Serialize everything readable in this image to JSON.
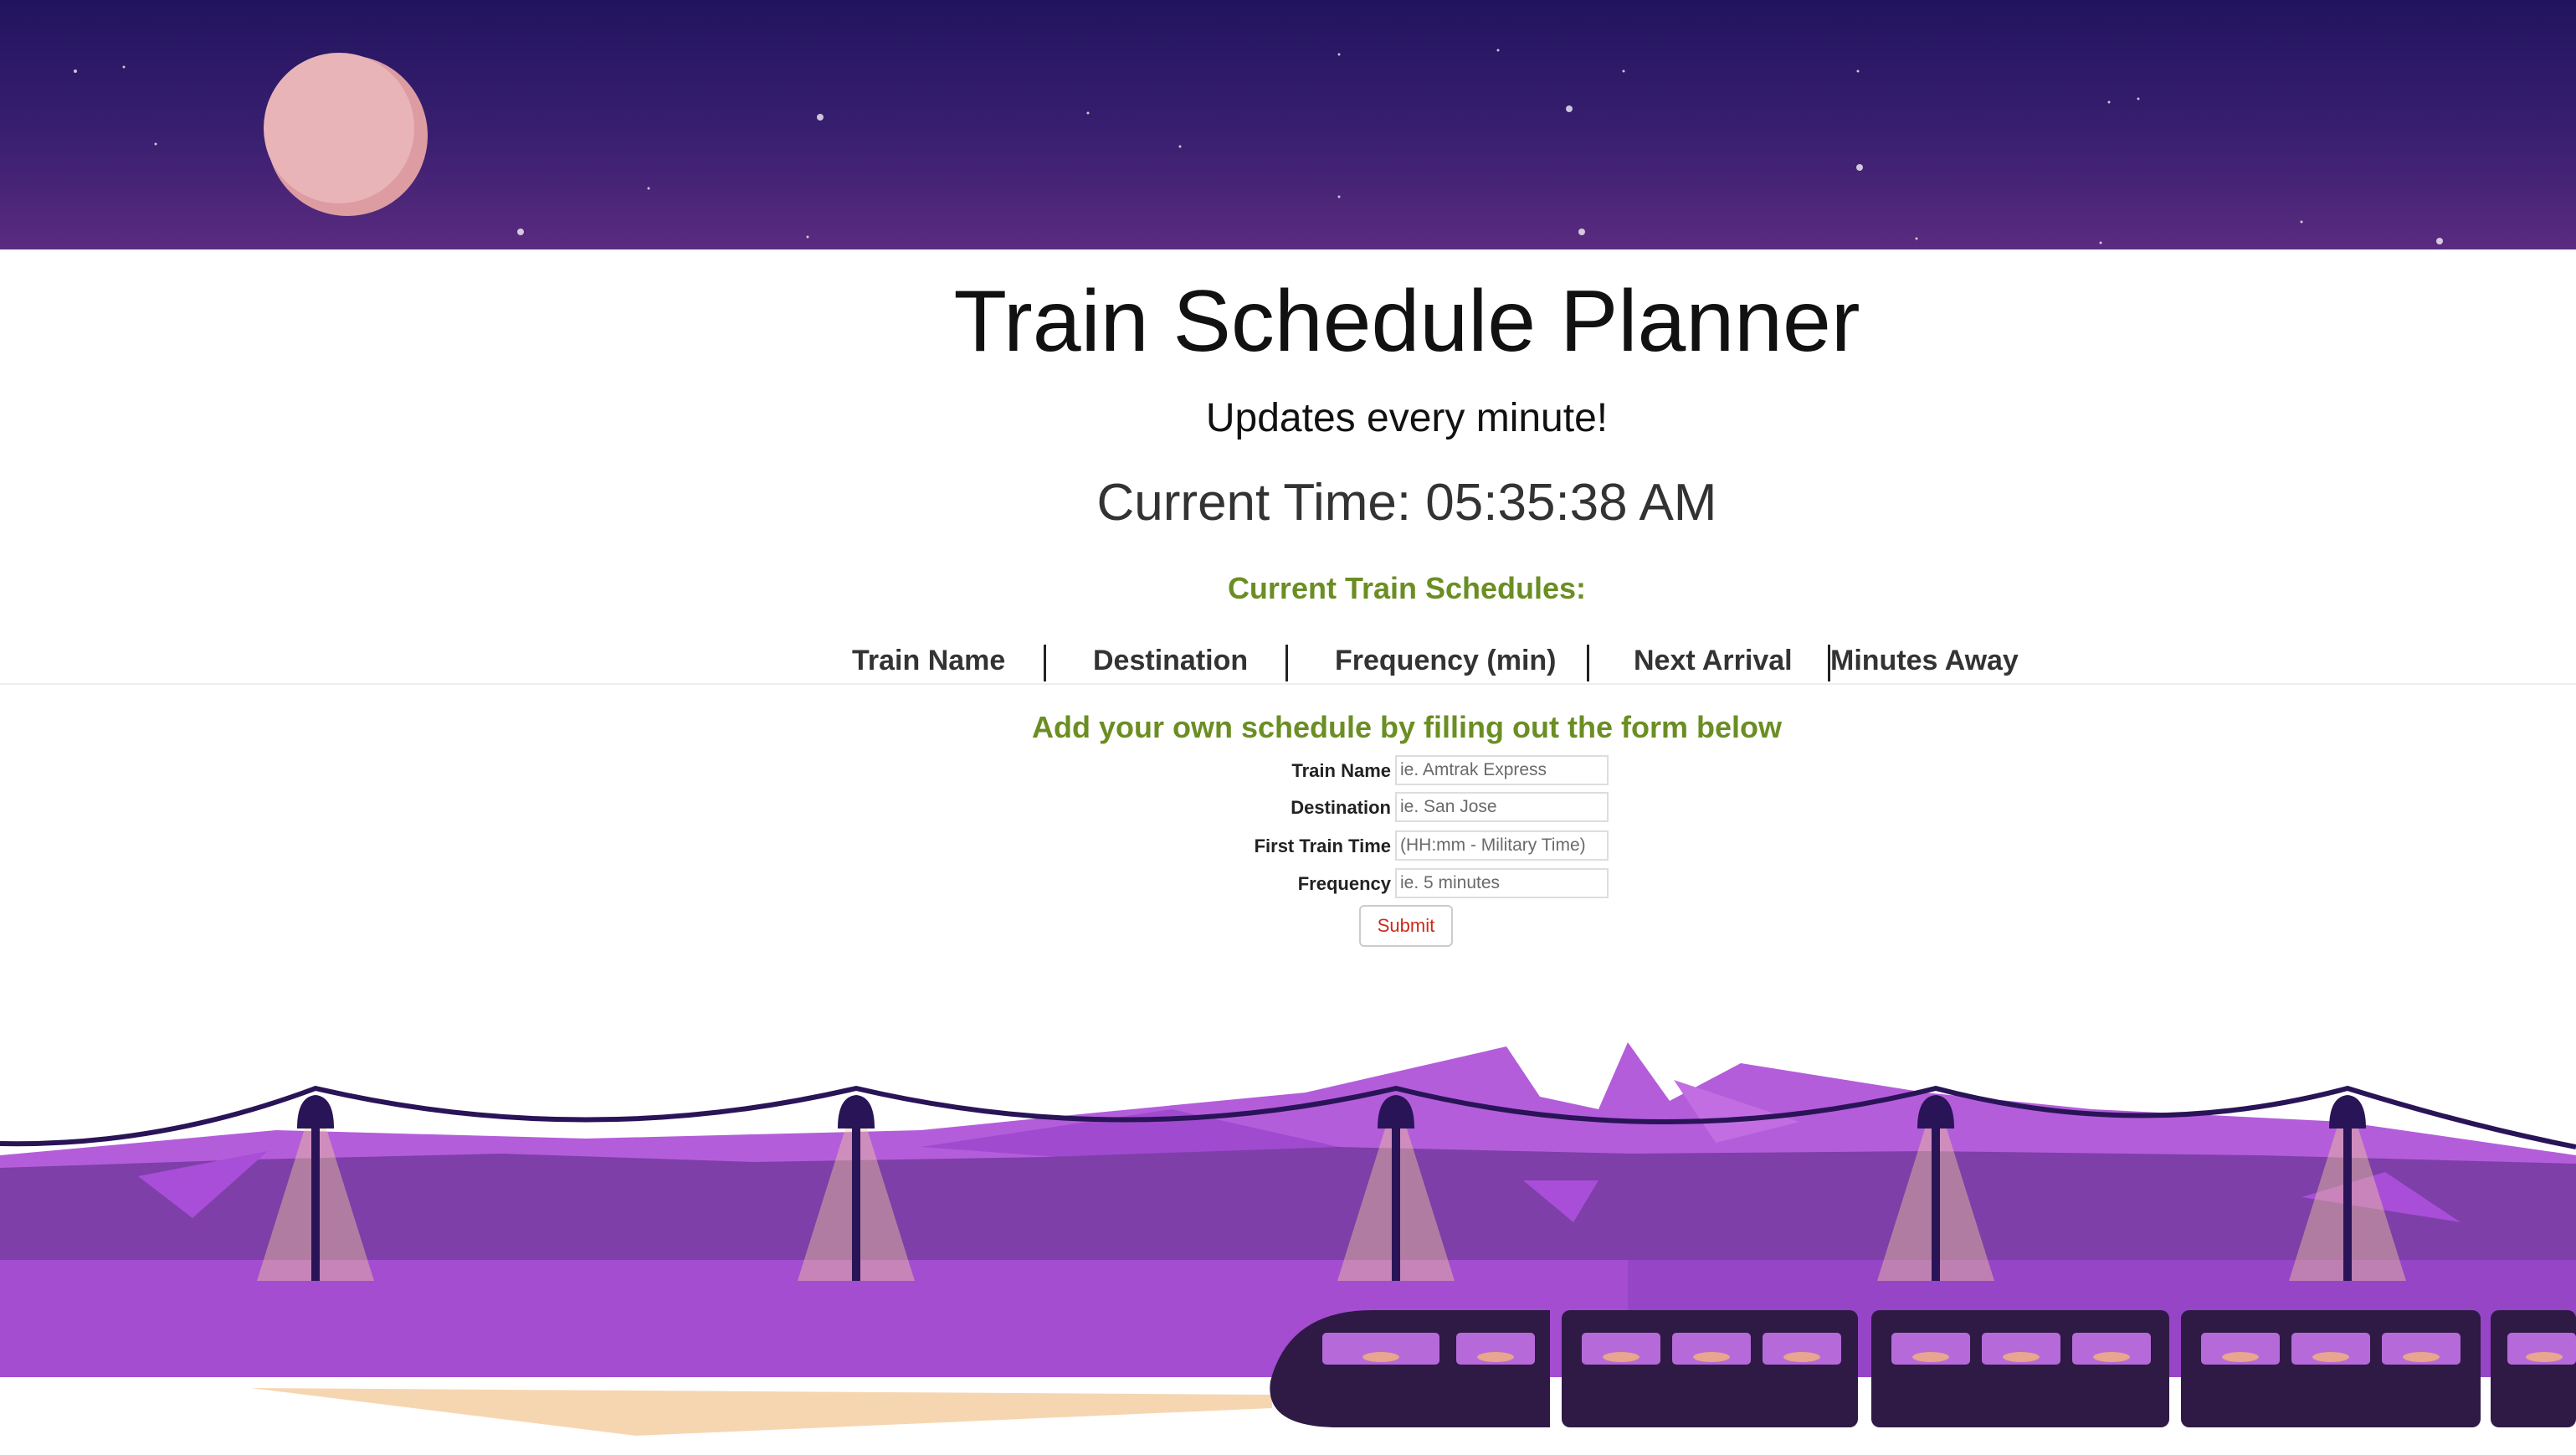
{
  "header": {
    "title": "Train Schedule Planner",
    "subtitle": "Updates every minute!",
    "current_time_label": "Current Time: 05:35:38 AM"
  },
  "schedules": {
    "heading": "Current Train Schedules:",
    "columns": [
      "Train Name",
      "Destination",
      "Frequency (min)",
      "Next Arrival",
      "Minutes Away"
    ],
    "rows": []
  },
  "form": {
    "heading": "Add your own schedule by filling out the form below",
    "fields": [
      {
        "label": "Train Name",
        "placeholder": "ie. Amtrak Express",
        "value": ""
      },
      {
        "label": "Destination",
        "placeholder": "ie. San Jose",
        "value": ""
      },
      {
        "label": "First Train Time",
        "placeholder": "(HH:mm - Military Time)",
        "value": ""
      },
      {
        "label": "Frequency",
        "placeholder": "ie. 5 minutes",
        "value": ""
      }
    ],
    "submit_label": "Submit"
  },
  "colors": {
    "sky_top": "#21145f",
    "sky_bottom": "#5a2b80",
    "moon": "#e8b4b8",
    "accent_green": "#6b8e23",
    "submit_red": "#cc2a1a",
    "mountain_purple": "#9b4fc9",
    "train_dark": "#2e1a45"
  },
  "icons": {
    "moon": "moon-illustration",
    "train": "train-illustration",
    "lamps": "street-lamp-illustration"
  }
}
